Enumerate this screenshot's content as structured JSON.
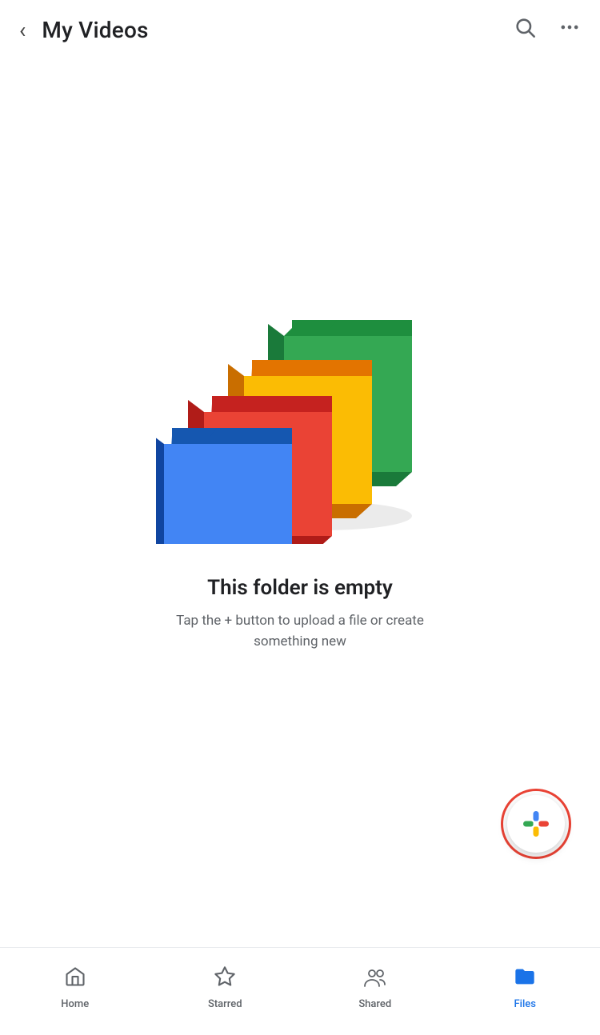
{
  "header": {
    "back_label": "‹",
    "title": "My Videos",
    "search_label": "search",
    "more_label": "more"
  },
  "empty_state": {
    "title": "This folder is empty",
    "subtitle": "Tap the + button to upload a file or create something new"
  },
  "fab": {
    "label": "+"
  },
  "bottom_nav": {
    "items": [
      {
        "id": "home",
        "label": "Home",
        "icon": "⌂",
        "active": false
      },
      {
        "id": "starred",
        "label": "Starred",
        "icon": "☆",
        "active": false
      },
      {
        "id": "shared",
        "label": "Shared",
        "icon": "👥",
        "active": false
      },
      {
        "id": "files",
        "label": "Files",
        "icon": "📁",
        "active": true
      }
    ]
  },
  "colors": {
    "accent_blue": "#1a73e8",
    "accent_red": "#ea4335",
    "text_primary": "#202124",
    "text_secondary": "#5f6368"
  }
}
